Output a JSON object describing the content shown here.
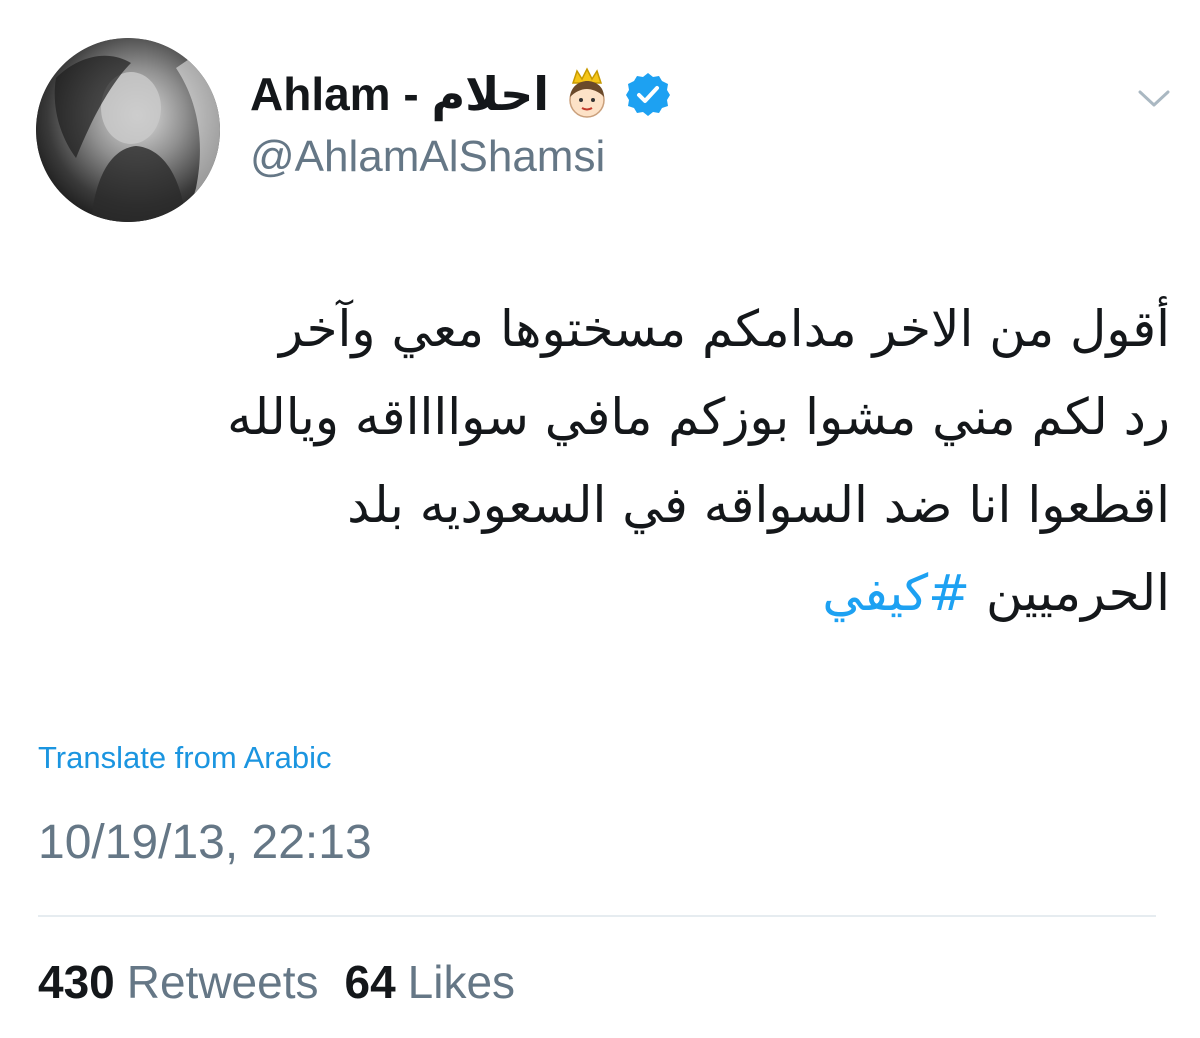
{
  "author": {
    "display_name": "Ahlam - احلام",
    "handle": "@AhlamAlShamsi",
    "verified": true,
    "emoji_icon": "princess-icon",
    "verified_icon": "verified-badge-icon"
  },
  "tweet": {
    "lines": [
      "أقول من الاخر مدامكم مسختوها معي وآخر",
      "رد لكم مني مشوا بوزكم مافي سوااااقه ويالله",
      "اقطعوا انا ضد السواقه في السعوديه بلد"
    ],
    "last_line_text": "الحرميين",
    "hashtag": "#كيفي"
  },
  "translate_label": "Translate from Arabic",
  "timestamp": "10/19/13, 22:13",
  "stats": {
    "retweets_count": "430",
    "retweets_label": "Retweets",
    "likes_count": "64",
    "likes_label": "Likes"
  },
  "colors": {
    "text": "#14171a",
    "secondary": "#657786",
    "link": "#1da1f2",
    "verified": "#1da1f2"
  }
}
